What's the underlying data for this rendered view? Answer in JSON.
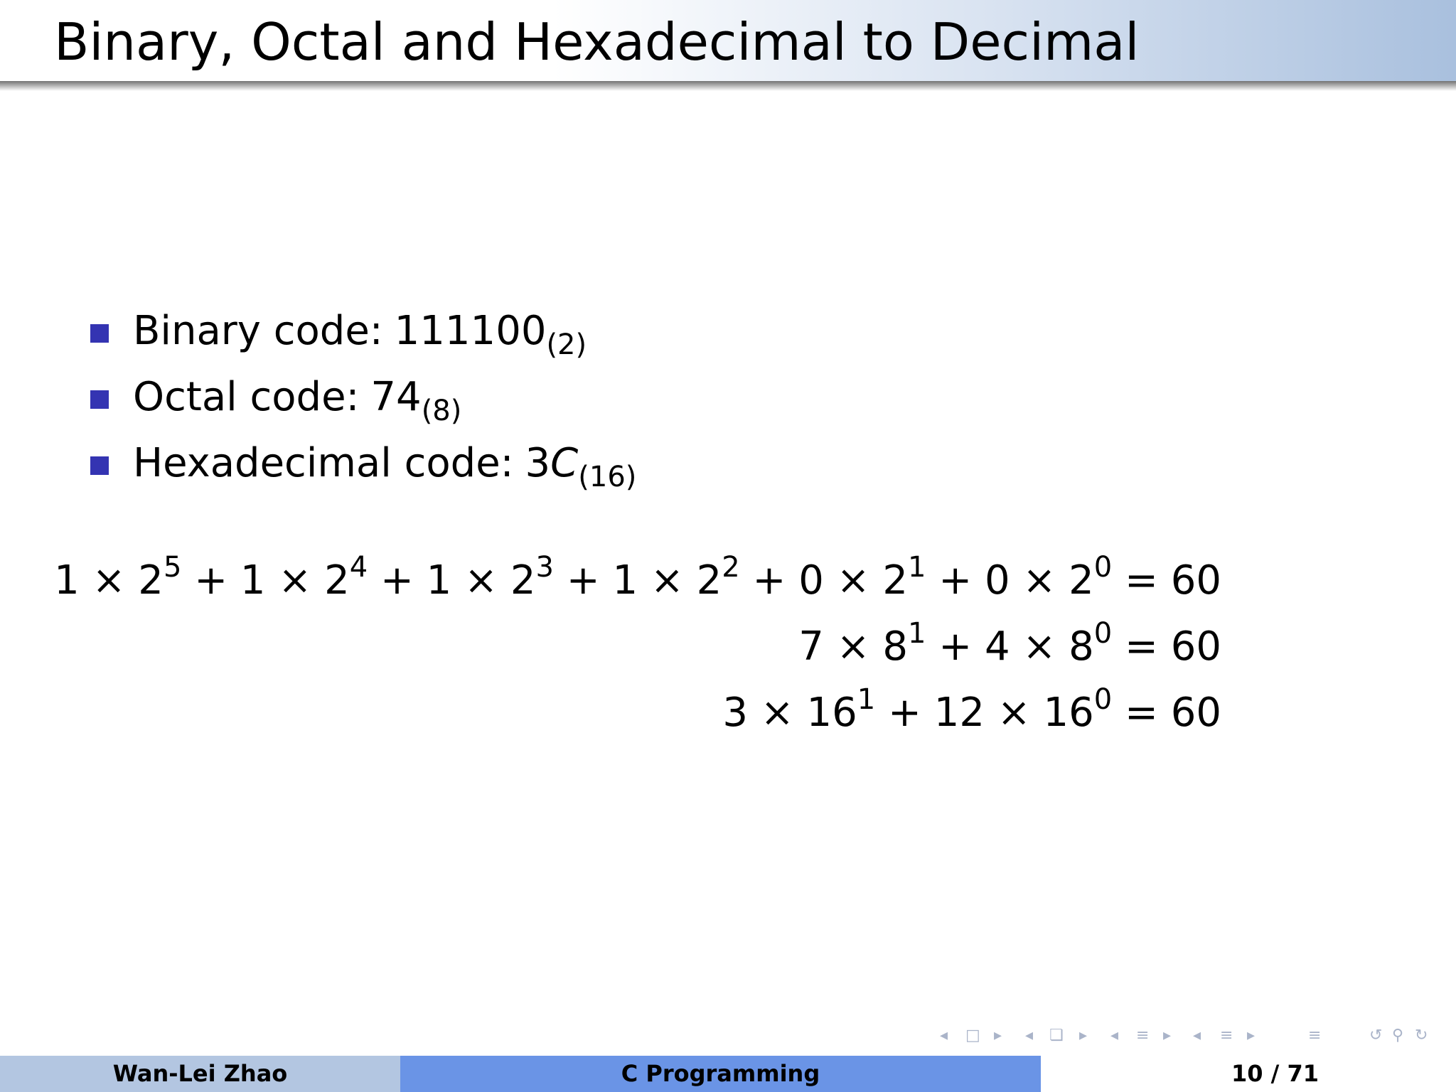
{
  "slide": {
    "title": "Binary, Octal and Hexadecimal to Decimal"
  },
  "bullets": [
    {
      "label": "Binary code:",
      "value": "111100",
      "base": "(2)"
    },
    {
      "label": "Octal code:",
      "value": "74",
      "base": "(8)"
    },
    {
      "label": "Hexadecimal code:",
      "value_digit": "3",
      "value_letter": "C",
      "base": "(16)"
    }
  ],
  "equations": {
    "binary": {
      "t1": "1 × 2",
      "e1": "5",
      "t2": " + 1 × 2",
      "e2": "4",
      "t3": " + 1 × 2",
      "e3": "3",
      "t4": " + 1 × 2",
      "e4": "2",
      "t5": " + 0 × 2",
      "e5": "1",
      "t6": " + 0 × 2",
      "e6": "0",
      "result": " = 60"
    },
    "octal": {
      "t1": "7 × 8",
      "e1": "1",
      "t2": " + 4 × 8",
      "e2": "0",
      "result": " = 60"
    },
    "hex": {
      "t1": "3 × 16",
      "e1": "1",
      "t2": " + 12 × 16",
      "e2": "0",
      "result": " = 60"
    }
  },
  "navigation": {
    "icons": [
      "prev-arrow",
      "frame",
      "next-arrow",
      "prev-arrow",
      "subsection",
      "next-arrow",
      "prev-arrow",
      "section",
      "next-arrow",
      "prev-arrow",
      "appendix",
      "next-arrow",
      "toc",
      "back",
      "forward",
      "search"
    ],
    "color": "#aab4c9"
  },
  "footer": {
    "author": "Wan-Lei Zhao",
    "course": "C Programming",
    "page": "10 / 71"
  },
  "colors": {
    "bullet": "#3434b2",
    "footer_author_bg": "#b3c6e1",
    "footer_course_bg": "#6a94e6"
  }
}
